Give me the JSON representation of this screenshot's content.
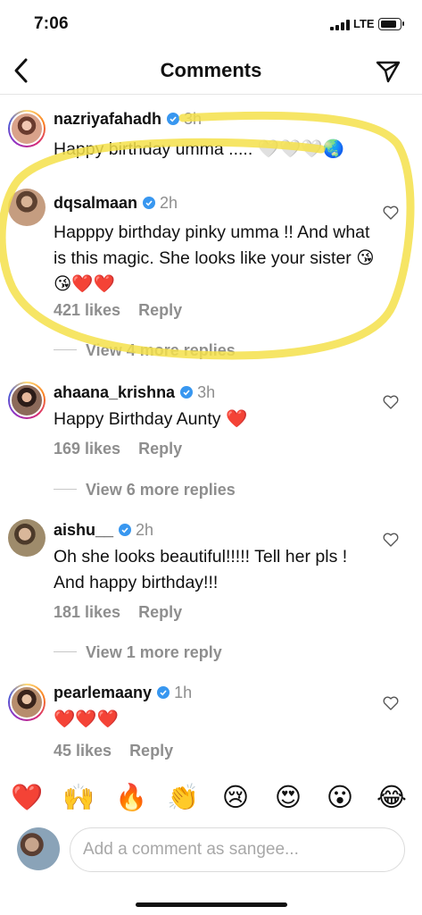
{
  "status_bar": {
    "time": "7:06",
    "network": "LTE",
    "battery_level": 0.85
  },
  "header": {
    "title": "Comments",
    "back_icon": "chevron-left-icon",
    "send_icon": "paper-plane-icon"
  },
  "comments": [
    {
      "username": "nazriyafahadh",
      "verified": true,
      "age": "3h",
      "text": "Happy birthday umma ..... 🤍🤍🤍🌏",
      "likes": "",
      "reply": ""
    },
    {
      "username": "dqsalmaan",
      "verified": true,
      "age": "2h",
      "text": "Happpy birthday pinky umma !! And what is this magic. She looks like your sister 😘😘❤️❤️",
      "likes": "421 likes",
      "reply": "Reply",
      "more_replies": "View 4 more replies"
    },
    {
      "username": "ahaana_krishna",
      "verified": true,
      "age": "3h",
      "text": "Happy Birthday Aunty ❤️",
      "likes": "169 likes",
      "reply": "Reply",
      "more_replies": "View 6 more replies"
    },
    {
      "username": "aishu__",
      "verified": true,
      "age": "2h",
      "text": "Oh she looks beautiful!!!!! Tell her pls ! And happy birthday!!!",
      "likes": "181 likes",
      "reply": "Reply",
      "more_replies": "View 1 more reply"
    },
    {
      "username": "pearlemaany",
      "verified": true,
      "age": "1h",
      "text": "❤️❤️❤️",
      "likes": "45 likes",
      "reply": "Reply"
    }
  ],
  "reactions": [
    "❤️",
    "🙌",
    "🔥",
    "👏",
    "😢",
    "😍",
    "😮",
    "😂"
  ],
  "composer": {
    "placeholder": "Add a comment as sangee..."
  },
  "colors": {
    "highlight": "#f5e04a",
    "verified": "#3897f0",
    "muted": "#8e8e8e"
  }
}
